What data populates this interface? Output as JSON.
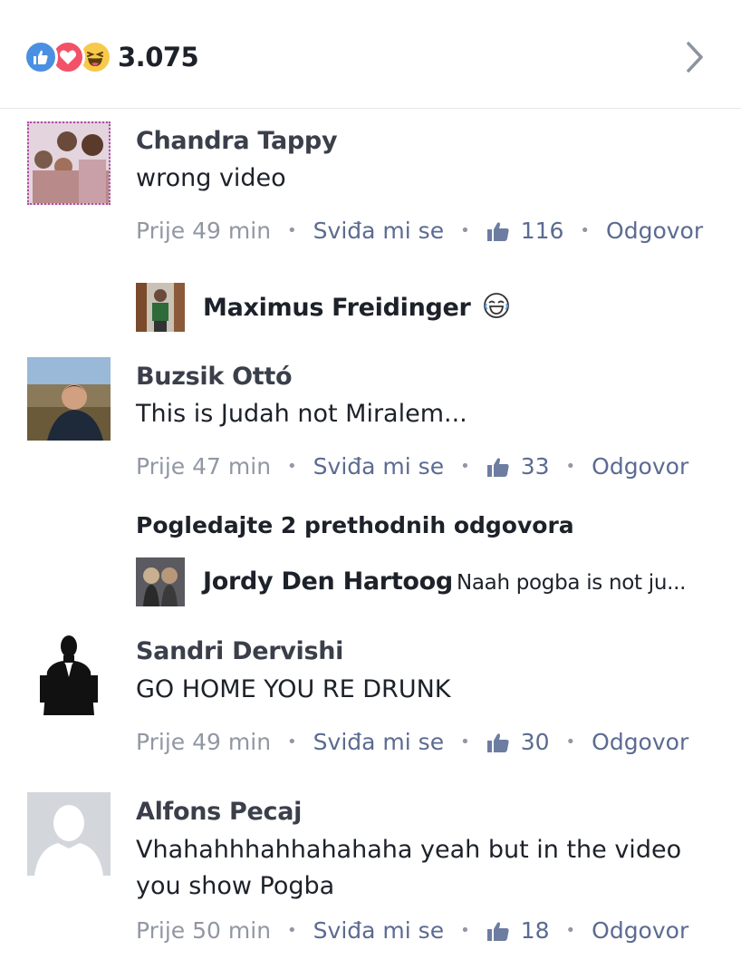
{
  "reactions": {
    "count": "3.075",
    "icons": [
      "like-icon",
      "love-icon",
      "haha-icon"
    ],
    "colors": {
      "like": "#4a90e2",
      "love": "#f25268",
      "haha": "#f7c94b"
    }
  },
  "comments": [
    {
      "name": "Chandra Tappy",
      "text": "wrong video",
      "time": "Prije 49 min",
      "like_label": "Sviđa mi se",
      "likes": "116",
      "reply_label": "Odgovor"
    },
    {
      "name": "Buzsik Ottó",
      "text": "This is Judah not Miralem...",
      "time": "Prije 47 min",
      "like_label": "Sviđa mi se",
      "likes": "33",
      "reply_label": "Odgovor"
    },
    {
      "name": "Sandri Dervishi",
      "text": "GO HOME YOU RE DRUNK",
      "time": "Prije 49 min",
      "like_label": "Sviđa mi se",
      "likes": "30",
      "reply_label": "Odgovor"
    },
    {
      "name": "Alfons Pecaj",
      "text": "Vhahahhhahhahahaha yeah but in the video you show Pogba",
      "time": "Prije 50 min",
      "like_label": "Sviđa mi se",
      "likes": "18",
      "reply_label": "Odgovor"
    }
  ],
  "replies": [
    {
      "name": "Maximus Freidinger",
      "text": "",
      "emoji": "😂"
    },
    {
      "name": "Jordy Den Hartoog",
      "text": "Naah pogba is not ju..."
    }
  ],
  "view_previous_replies": "Pogledajte 2 prethodnih odgovora",
  "theme": {
    "link": "#5b6b91",
    "meta": "#9197a3",
    "name": "#3a3f4a"
  }
}
